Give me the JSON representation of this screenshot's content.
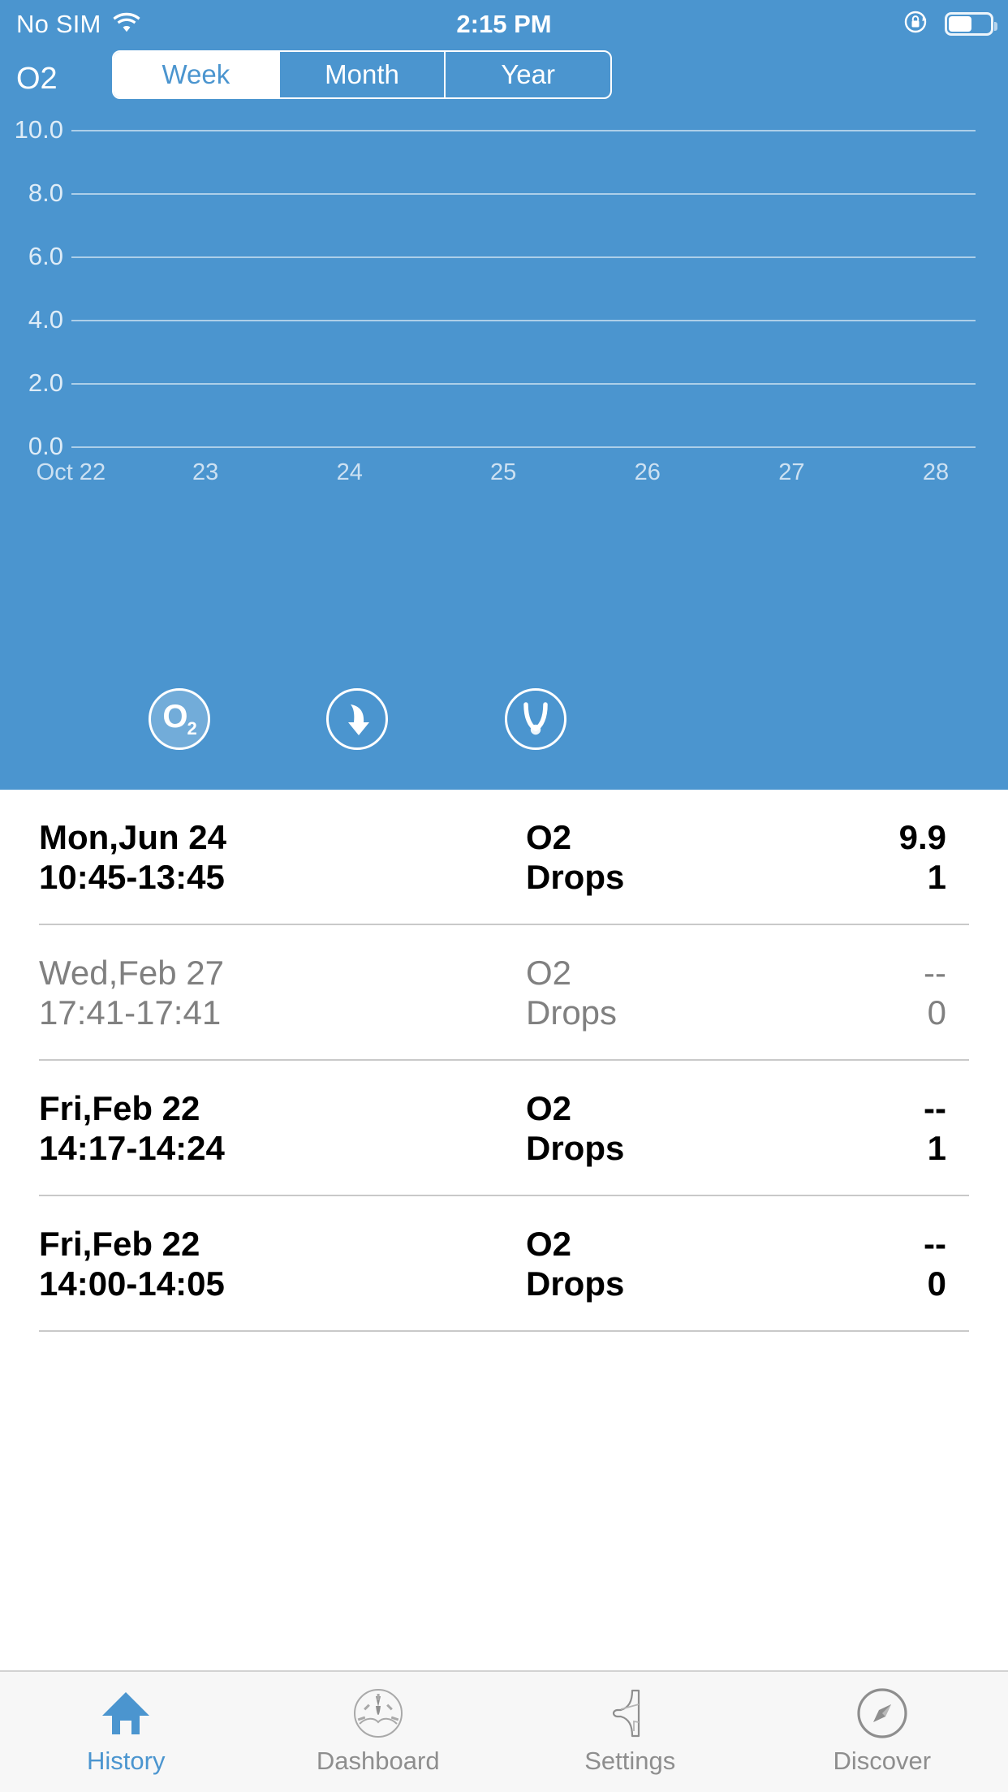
{
  "status_bar": {
    "carrier": "No SIM",
    "time": "2:15 PM",
    "wifi_icon": "wifi-icon",
    "rotation_lock_icon": "rotation-lock-icon",
    "battery_icon": "battery-icon",
    "battery_level_percent": 52
  },
  "header": {
    "title": "O2",
    "segments": [
      {
        "label": "Week",
        "selected": true
      },
      {
        "label": "Month",
        "selected": false
      },
      {
        "label": "Year",
        "selected": false
      }
    ]
  },
  "metric_buttons": [
    {
      "name": "o2-metric-button",
      "icon": "o2-icon",
      "selected": true
    },
    {
      "name": "drops-metric-button",
      "icon": "drop-arrow-icon",
      "selected": false
    },
    {
      "name": "nasal-metric-button",
      "icon": "nasal-cannula-icon",
      "selected": false
    }
  ],
  "chart_data": {
    "type": "line",
    "title": "O2",
    "xlabel": "",
    "ylabel": "",
    "x": [
      "Oct 22",
      "23",
      "24",
      "25",
      "26",
      "27",
      "28"
    ],
    "xtick_labels": [
      "Oct 22",
      "23",
      "24",
      "25",
      "26",
      "27",
      "28"
    ],
    "ytick_labels": [
      "10.0",
      "8.0",
      "6.0",
      "4.0",
      "2.0",
      "0.0"
    ],
    "ytick_values": [
      10.0,
      8.0,
      6.0,
      4.0,
      2.0,
      0.0
    ],
    "ylim": [
      0.0,
      10.0
    ],
    "series": [
      {
        "name": "O2",
        "values": [
          null,
          null,
          null,
          null,
          null,
          null,
          null
        ]
      }
    ],
    "grid": true,
    "legend": false,
    "note": "No data plotted in the visible week range"
  },
  "list": {
    "columns": [
      "date_time",
      "metric",
      "value"
    ],
    "rows": [
      {
        "date": "Mon,Jun 24",
        "time": "10:45-13:45",
        "metric_1": "O2",
        "metric_2": "Drops",
        "value_1": "9.9",
        "value_2": "1",
        "dim": false
      },
      {
        "date": "Wed,Feb 27",
        "time": "17:41-17:41",
        "metric_1": "O2",
        "metric_2": "Drops",
        "value_1": "--",
        "value_2": "0",
        "dim": true
      },
      {
        "date": "Fri,Feb 22",
        "time": "14:17-14:24",
        "metric_1": "O2",
        "metric_2": "Drops",
        "value_1": "--",
        "value_2": "1",
        "dim": false
      },
      {
        "date": "Fri,Feb 22",
        "time": "14:00-14:05",
        "metric_1": "O2",
        "metric_2": "Drops",
        "value_1": "--",
        "value_2": "0",
        "dim": false
      }
    ]
  },
  "tabbar": {
    "items": [
      {
        "label": "History",
        "icon": "home-icon",
        "active": true
      },
      {
        "label": "Dashboard",
        "icon": "gauge-icon",
        "active": false
      },
      {
        "label": "Settings",
        "icon": "wrench-icon",
        "active": false
      },
      {
        "label": "Discover",
        "icon": "compass-icon",
        "active": false
      }
    ]
  },
  "colors": {
    "accent_blue": "#4b95cf",
    "tabbar_bg": "#f7f7f7",
    "inactive_gray": "#8e8e8e",
    "dim_text": "#808080",
    "separator": "#c9c9c9"
  }
}
